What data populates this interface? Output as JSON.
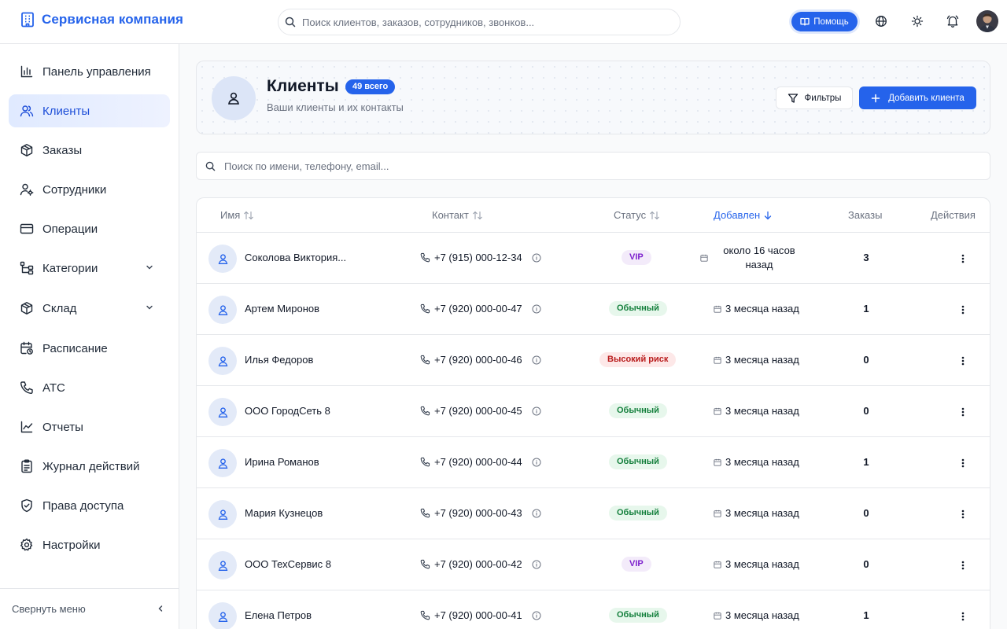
{
  "app": {
    "brand": "Сервисная компания"
  },
  "header": {
    "search_placeholder": "Поиск клиентов, заказов, сотрудников, звонков...",
    "help_label": "Помощь"
  },
  "sidebar": {
    "items": [
      {
        "label": "Панель управления",
        "icon": "chart-bar-icon"
      },
      {
        "label": "Клиенты",
        "icon": "users-icon",
        "active": true
      },
      {
        "label": "Заказы",
        "icon": "box-icon"
      },
      {
        "label": "Сотрудники",
        "icon": "user-cog-icon"
      },
      {
        "label": "Операции",
        "icon": "credit-card-icon"
      },
      {
        "label": "Категории",
        "icon": "tree-icon",
        "expandable": true
      },
      {
        "label": "Склад",
        "icon": "package-icon",
        "expandable": true
      },
      {
        "label": "Расписание",
        "icon": "calendar-clock-icon"
      },
      {
        "label": "АТС",
        "icon": "phone-icon"
      },
      {
        "label": "Отчеты",
        "icon": "line-chart-icon"
      },
      {
        "label": "Журнал действий",
        "icon": "clipboard-icon"
      },
      {
        "label": "Права доступа",
        "icon": "shield-icon"
      },
      {
        "label": "Настройки",
        "icon": "gear-icon"
      }
    ],
    "collapse_label": "Свернуть меню"
  },
  "page": {
    "title": "Клиенты",
    "count_badge": "49 всего",
    "subtitle": "Ваши клиенты и их контакты",
    "filters_label": "Фильтры",
    "add_label": "Добавить клиента",
    "search_placeholder": "Поиск по имени, телефону, email..."
  },
  "table": {
    "columns": {
      "name": "Имя",
      "contact": "Контакт",
      "status": "Статус",
      "added": "Добавлен",
      "orders": "Заказы",
      "actions": "Действия"
    },
    "rows": [
      {
        "name": "Соколова Виктория...",
        "phone": "+7 (915) 000-12-34",
        "status": "VIP",
        "status_type": "vip",
        "added": "около 16 часов назад",
        "orders": "3"
      },
      {
        "name": "Артем Миронов",
        "phone": "+7 (920) 000-00-47",
        "status": "Обычный",
        "status_type": "normal",
        "added": "3 месяца назад",
        "orders": "1"
      },
      {
        "name": "Илья Федоров",
        "phone": "+7 (920) 000-00-46",
        "status": "Высокий риск",
        "status_type": "risk",
        "added": "3 месяца назад",
        "orders": "0"
      },
      {
        "name": "ООО ГородСеть 8",
        "phone": "+7 (920) 000-00-45",
        "status": "Обычный",
        "status_type": "normal",
        "added": "3 месяца назад",
        "orders": "0"
      },
      {
        "name": "Ирина Романов",
        "phone": "+7 (920) 000-00-44",
        "status": "Обычный",
        "status_type": "normal",
        "added": "3 месяца назад",
        "orders": "1"
      },
      {
        "name": "Мария Кузнецов",
        "phone": "+7 (920) 000-00-43",
        "status": "Обычный",
        "status_type": "normal",
        "added": "3 месяца назад",
        "orders": "0"
      },
      {
        "name": "ООО ТехСервис 8",
        "phone": "+7 (920) 000-00-42",
        "status": "VIP",
        "status_type": "vip",
        "added": "3 месяца назад",
        "orders": "0"
      },
      {
        "name": "Елена Петров",
        "phone": "+7 (920) 000-00-41",
        "status": "Обычный",
        "status_type": "normal",
        "added": "3 месяца назад",
        "orders": "1"
      }
    ]
  },
  "colors": {
    "accent": "#2563eb",
    "vip": "#7e22ce",
    "normal": "#15803d",
    "risk": "#b91c1c"
  }
}
